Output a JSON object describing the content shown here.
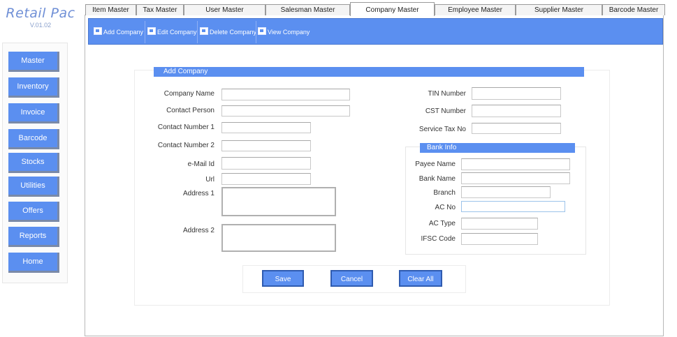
{
  "app": {
    "title": "Retail Pac",
    "version": "V.01.02"
  },
  "sidebar": {
    "items": [
      {
        "label": "Master"
      },
      {
        "label": "Inventory"
      },
      {
        "label": "Invoice"
      },
      {
        "label": "Barcode"
      },
      {
        "label": "Stocks"
      },
      {
        "label": "Utilities"
      },
      {
        "label": "Offers"
      },
      {
        "label": "Reports"
      },
      {
        "label": "Home"
      }
    ]
  },
  "tabs": [
    {
      "label": "Item Master"
    },
    {
      "label": "Tax Master"
    },
    {
      "label": "User Master"
    },
    {
      "label": "Salesman Master"
    },
    {
      "label": "Company Master",
      "active": true
    },
    {
      "label": "Employee Master"
    },
    {
      "label": "Supplier Master"
    },
    {
      "label": "Barcode Master"
    }
  ],
  "toolbar": {
    "items": [
      {
        "label": "Add Company",
        "icon": "add-icon"
      },
      {
        "label": "Edit Company",
        "icon": "edit-icon"
      },
      {
        "label": "Delete Company",
        "icon": "delete-icon"
      },
      {
        "label": "View Company",
        "icon": "view-icon"
      }
    ]
  },
  "form": {
    "section_title": "Add Company",
    "left_fields": [
      {
        "label": "Company Name",
        "value": ""
      },
      {
        "label": "Contact Person",
        "value": ""
      },
      {
        "label": "Contact Number 1",
        "value": ""
      },
      {
        "label": "Contact Number 2",
        "value": ""
      },
      {
        "label": "e-Mail Id",
        "value": ""
      },
      {
        "label": "Url",
        "value": ""
      },
      {
        "label": "Address 1",
        "value": ""
      },
      {
        "label": "Address 2",
        "value": ""
      }
    ],
    "right_fields": [
      {
        "label": "TIN Number",
        "value": ""
      },
      {
        "label": "CST Number",
        "value": ""
      },
      {
        "label": "Service Tax No",
        "value": ""
      }
    ],
    "bank": {
      "title": "Bank Info",
      "fields": [
        {
          "label": "Payee Name",
          "value": ""
        },
        {
          "label": "Bank Name",
          "value": ""
        },
        {
          "label": "Branch",
          "value": ""
        },
        {
          "label": "AC No",
          "value": ""
        },
        {
          "label": "AC Type",
          "value": ""
        },
        {
          "label": "IFSC Code",
          "value": ""
        }
      ]
    },
    "buttons": {
      "save": "Save",
      "cancel": "Cancel",
      "clear": "Clear All"
    }
  },
  "colors": {
    "accent": "#5b8ff0",
    "brand": "#6f8fd6"
  }
}
